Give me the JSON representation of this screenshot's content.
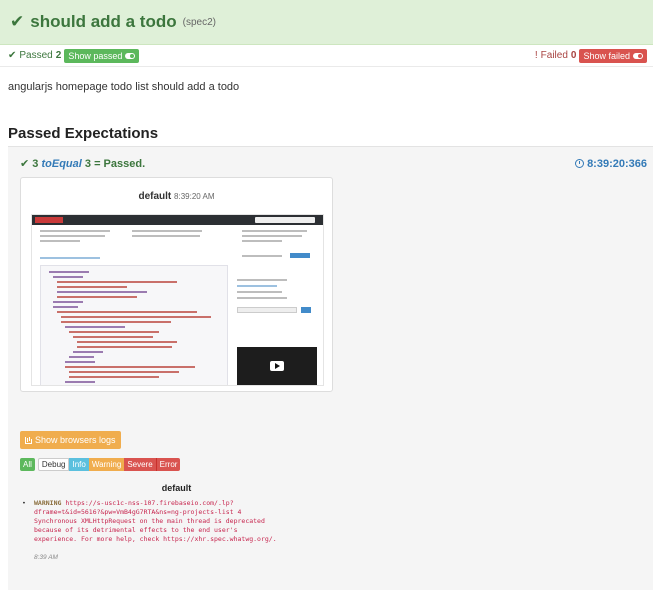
{
  "spec": {
    "title": "should add a todo",
    "subtitle": "(spec2)"
  },
  "status": {
    "passed_label": "Passed",
    "passed_count": "2",
    "show_passed": "Show passed",
    "failed_label": "Failed",
    "failed_count": "0",
    "show_failed": "Show failed"
  },
  "description": "angularjs homepage todo list should add a todo",
  "section_title": "Passed Expectations",
  "expectation": {
    "actual": "3",
    "matcher": "toEqual",
    "expected": "3",
    "result": "= Passed.",
    "time": "8:39:20:366"
  },
  "screenshot": {
    "browser": "default",
    "time": "8:39:20 AM"
  },
  "logs_button": "Show browsers logs",
  "filters": [
    "All",
    "Debug",
    "Info",
    "Warning",
    "Severe",
    "Error"
  ],
  "log": {
    "browser": "default",
    "level": "WARNING",
    "message": "https://s-usc1c-nss-107.firebaseio.com/.lp?\ndframe=t&id=5616?&pw=VmB4gG7RTA&ns=ng-projects-list 4\nSynchronous XMLHttpRequest on the main thread is deprecated\nbecause of its detrimental effects to the end user's\nexperience. For more help, check https://xhr.spec.whatwg.org/.",
    "time": "8:39 AM"
  },
  "colors": {
    "success": "#3c763d",
    "header_bg": "#dff0d8",
    "info": "#337ab7",
    "warning_btn": "#f0ad4e",
    "danger": "#d9534f"
  },
  "icons": [
    "check-icon",
    "toggle-icon",
    "clock-icon",
    "chart-icon"
  ]
}
